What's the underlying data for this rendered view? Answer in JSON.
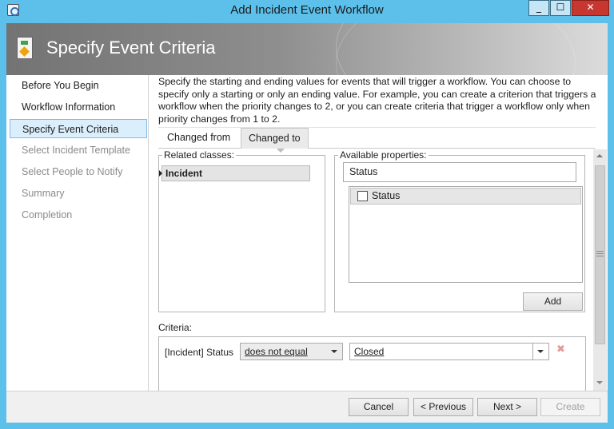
{
  "window": {
    "title": "Add Incident Event Workflow",
    "controls": {
      "minimize": "_",
      "maximize": "☐",
      "close": "✕"
    }
  },
  "header": {
    "title": "Specify Event Criteria"
  },
  "nav": {
    "items": [
      {
        "label": "Before You Begin",
        "state": "normal"
      },
      {
        "label": "Workflow Information",
        "state": "normal"
      },
      {
        "label": "Specify Event Criteria",
        "state": "selected"
      },
      {
        "label": "Select Incident Template",
        "state": "disabled"
      },
      {
        "label": "Select People to Notify",
        "state": "disabled"
      },
      {
        "label": "Summary",
        "state": "disabled"
      },
      {
        "label": "Completion",
        "state": "disabled"
      }
    ]
  },
  "main": {
    "description": "Specify the starting and ending values for events that will trigger a workflow. You can choose to specify only a starting or only an ending value. For example, you can create a criterion that triggers a workflow when the priority changes to 2, or you can create criteria that trigger a workflow only when priority changes from 1 to 2.",
    "tabs": [
      {
        "label": "Changed from",
        "active": false
      },
      {
        "label": "Changed to",
        "active": true
      }
    ],
    "related_classes": {
      "legend": "Related classes:",
      "items": [
        "Incident"
      ]
    },
    "available_properties": {
      "legend": "Available properties:",
      "search_value": "Status",
      "items": [
        {
          "label": "Status",
          "checked": false
        }
      ],
      "add_label": "Add"
    },
    "criteria": {
      "label": "Criteria:",
      "rows": [
        {
          "field": "[Incident] Status",
          "operator": "does not equal",
          "value": "Closed"
        }
      ],
      "remove_icon": "✖"
    }
  },
  "footer": {
    "cancel": "Cancel",
    "previous": "< Previous",
    "next": "Next >",
    "create": "Create"
  },
  "colors": {
    "window_frame": "#5cc0ea",
    "close_button": "#c7372f",
    "nav_selected_bg": "#dbeefb",
    "nav_selected_border": "#7fbde8"
  }
}
